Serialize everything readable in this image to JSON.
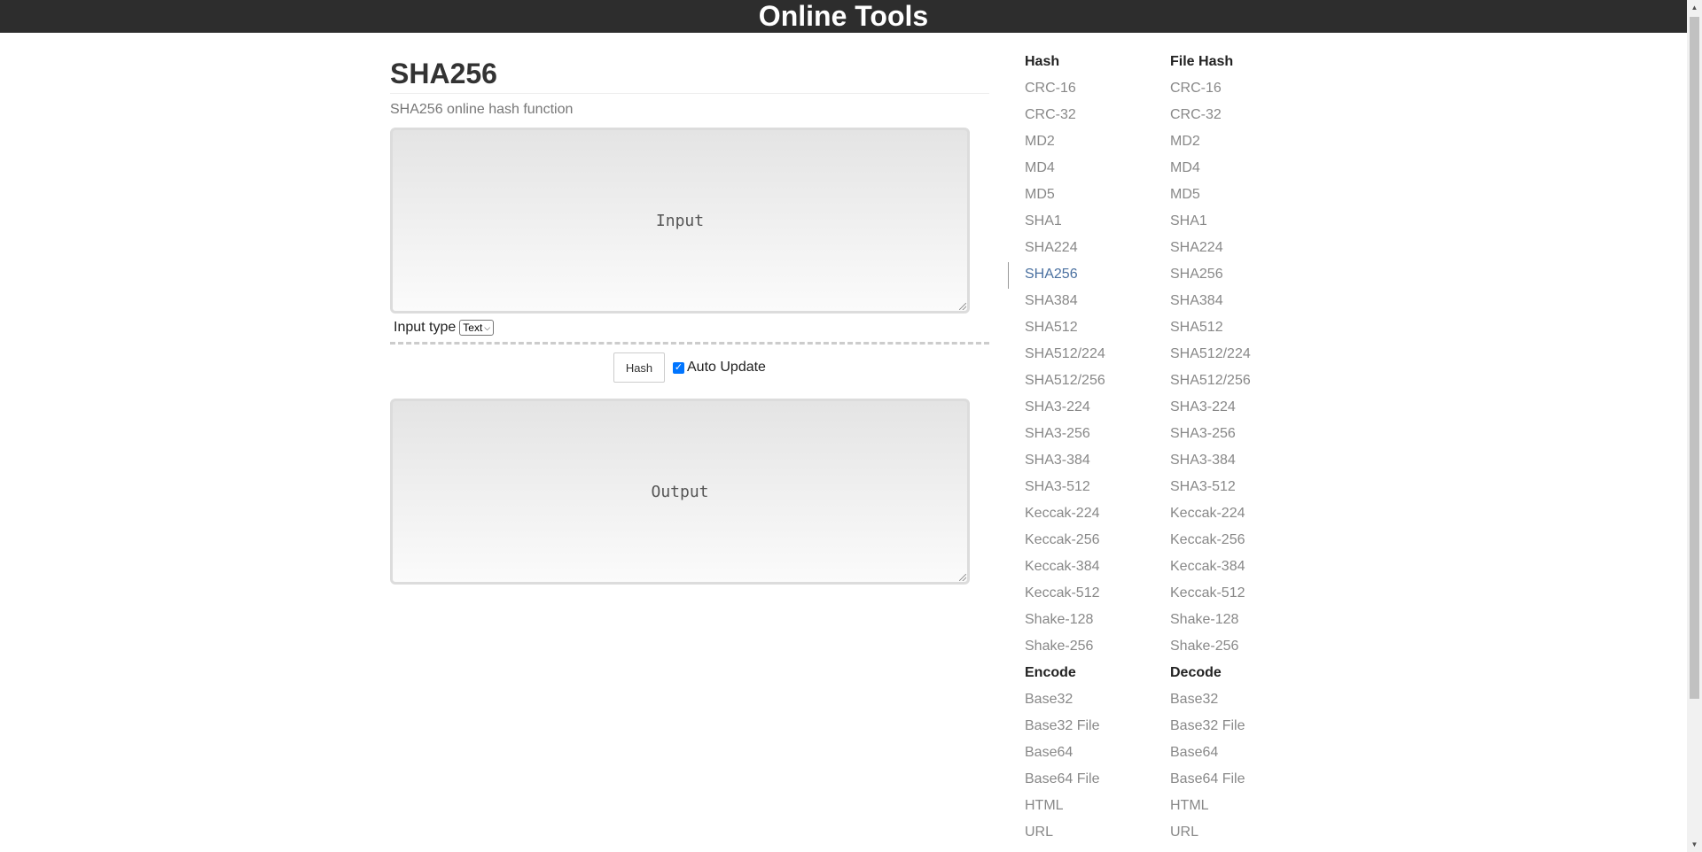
{
  "header": {
    "title": "Online Tools"
  },
  "page": {
    "title": "SHA256",
    "subtitle": "SHA256 online hash function",
    "input_placeholder": "Input",
    "input_type_label": "Input type",
    "input_type_value": "Text",
    "hash_button": "Hash",
    "auto_update_label": "Auto Update",
    "auto_update_checked": true,
    "output_placeholder": "Output"
  },
  "sidebar": {
    "hash": {
      "heading": "Hash",
      "items": [
        "CRC-16",
        "CRC-32",
        "MD2",
        "MD4",
        "MD5",
        "SHA1",
        "SHA224",
        "SHA256",
        "SHA384",
        "SHA512",
        "SHA512/224",
        "SHA512/256",
        "SHA3-224",
        "SHA3-256",
        "SHA3-384",
        "SHA3-512",
        "Keccak-224",
        "Keccak-256",
        "Keccak-384",
        "Keccak-512",
        "Shake-128",
        "Shake-256"
      ],
      "active": "SHA256"
    },
    "file_hash": {
      "heading": "File Hash",
      "items": [
        "CRC-16",
        "CRC-32",
        "MD2",
        "MD4",
        "MD5",
        "SHA1",
        "SHA224",
        "SHA256",
        "SHA384",
        "SHA512",
        "SHA512/224",
        "SHA512/256",
        "SHA3-224",
        "SHA3-256",
        "SHA3-384",
        "SHA3-512",
        "Keccak-224",
        "Keccak-256",
        "Keccak-384",
        "Keccak-512",
        "Shake-128",
        "Shake-256"
      ]
    },
    "encode": {
      "heading": "Encode",
      "items": [
        "Base32",
        "Base32 File",
        "Base64",
        "Base64 File",
        "HTML",
        "URL"
      ]
    },
    "decode": {
      "heading": "Decode",
      "items": [
        "Base32",
        "Base32 File",
        "Base64",
        "Base64 File",
        "HTML",
        "URL"
      ]
    }
  },
  "colors": {
    "header_bg": "#2d2d2d",
    "link": "#888888",
    "active_link": "#4a70a0",
    "checkbox": "#0075ff"
  }
}
